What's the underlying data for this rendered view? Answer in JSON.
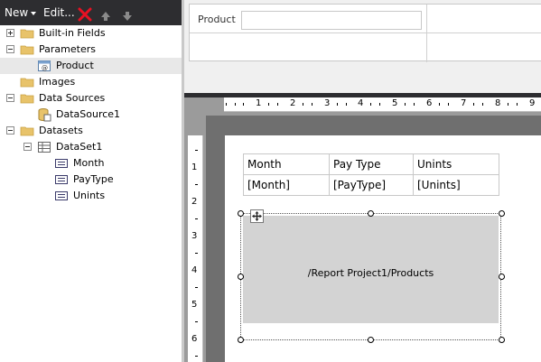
{
  "toolbar": {
    "new_label": "New",
    "edit_label": "Edit...",
    "icons": [
      "dropdown-arrow-icon",
      "delete-icon",
      "move-up-icon",
      "move-down-icon"
    ]
  },
  "tree": {
    "nodes": [
      {
        "label": "Built-in Fields",
        "icon": "folder-icon",
        "expander": "plus"
      },
      {
        "label": "Parameters",
        "icon": "folder-icon",
        "expander": "minus"
      },
      {
        "label": "Product",
        "icon": "parameter-icon",
        "selected": true
      },
      {
        "label": "Images",
        "icon": "folder-icon"
      },
      {
        "label": "Data Sources",
        "icon": "folder-icon",
        "expander": "minus"
      },
      {
        "label": "DataSource1",
        "icon": "datasource-icon"
      },
      {
        "label": "Datasets",
        "icon": "folder-icon",
        "expander": "minus"
      },
      {
        "label": "DataSet1",
        "icon": "dataset-icon",
        "expander": "minus"
      },
      {
        "label": "Month",
        "icon": "field-icon"
      },
      {
        "label": "PayType",
        "icon": "field-icon"
      },
      {
        "label": "Unints",
        "icon": "field-icon"
      }
    ]
  },
  "parameters": {
    "product_label": "Product",
    "product_value": ""
  },
  "ruler": {
    "horizontal": [
      "1",
      "2",
      "3",
      "4",
      "5",
      "6",
      "7",
      "8",
      "9"
    ],
    "vertical": [
      "1",
      "2",
      "3",
      "4",
      "5",
      "6"
    ]
  },
  "report_table": {
    "headers": [
      "Month",
      "Pay Type",
      "Unints"
    ],
    "row": [
      "[Month]",
      "[PayType]",
      "[Unints]"
    ]
  },
  "subreport": {
    "text": "/Report Project1/Products"
  },
  "colors": {
    "toolbar_bg": "#2d2d30",
    "folder": "#e8c36a",
    "selection": "#e8e8e8",
    "delete": "#e81123",
    "subreport_fill": "#d3d3d3"
  }
}
